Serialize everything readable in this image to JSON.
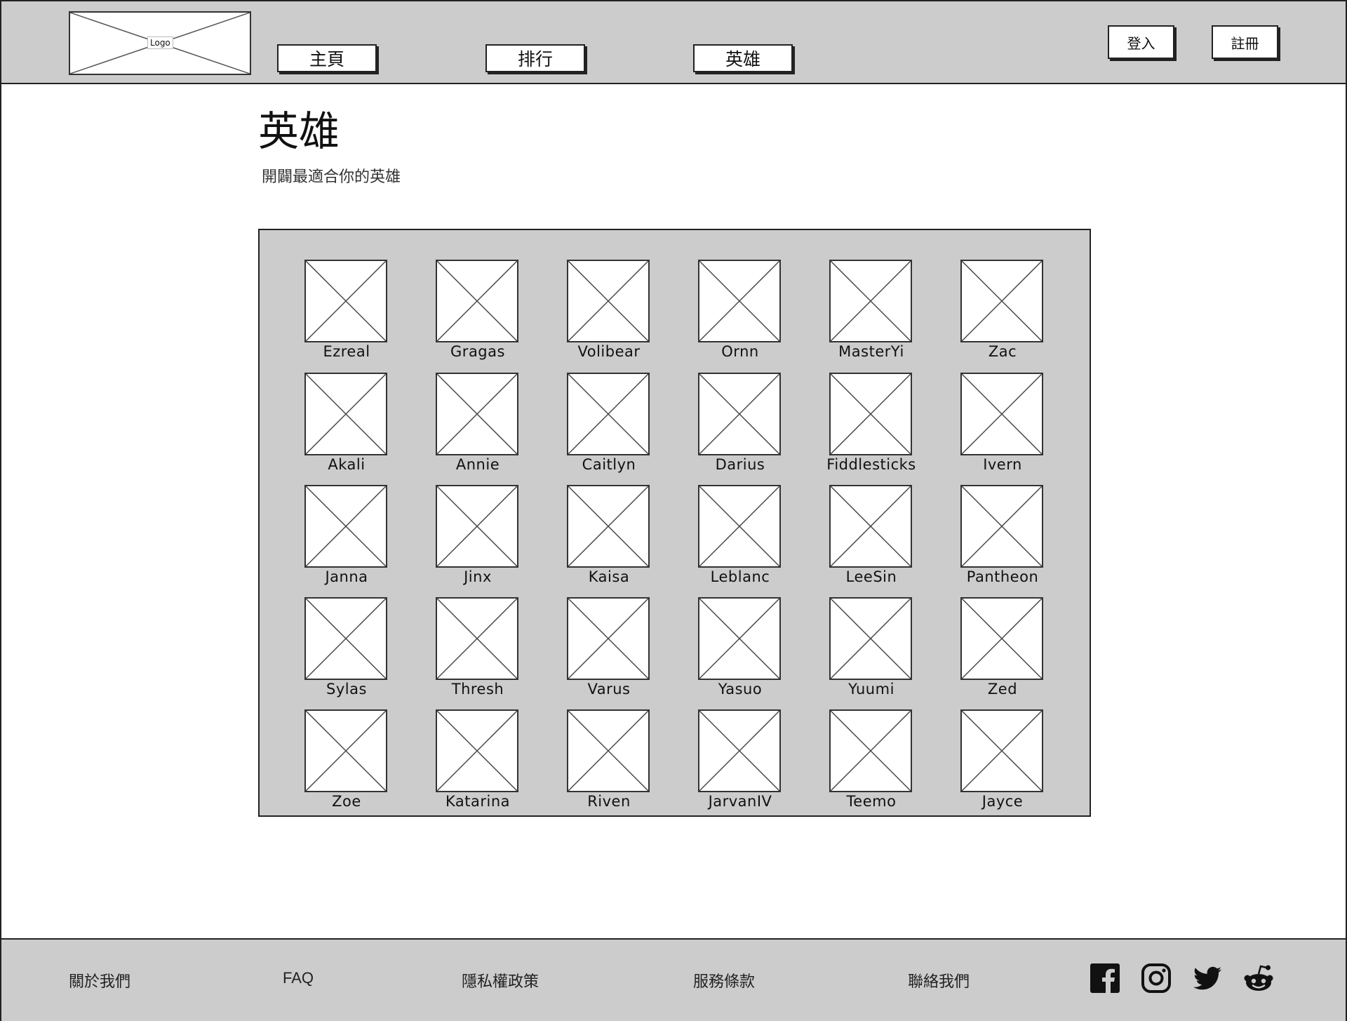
{
  "header": {
    "logo_label": "Logo",
    "nav": [
      {
        "label": "主頁"
      },
      {
        "label": "排行"
      },
      {
        "label": "英雄"
      }
    ],
    "login_label": "登入",
    "register_label": "註冊"
  },
  "main": {
    "title": "英雄",
    "subtitle": "開闢最適合你的英雄",
    "heroes": [
      "Ezreal",
      "Gragas",
      "Volibear",
      "Ornn",
      "MasterYi",
      "Zac",
      "Akali",
      "Annie",
      "Caitlyn",
      "Darius",
      "Fiddlesticks",
      "Ivern",
      "Janna",
      "Jinx",
      "Kaisa",
      "Leblanc",
      "LeeSin",
      "Pantheon",
      "Sylas",
      "Thresh",
      "Varus",
      "Yasuo",
      "Yuumi",
      "Zed",
      "Zoe",
      "Katarina",
      "Riven",
      "JarvanIV",
      "Teemo",
      "Jayce"
    ]
  },
  "footer": {
    "links": [
      {
        "label": "關於我們"
      },
      {
        "label": "FAQ"
      },
      {
        "label": "隱私權政策"
      },
      {
        "label": "服務條款"
      },
      {
        "label": "聯絡我們"
      }
    ],
    "social": [
      "facebook-icon",
      "instagram-icon",
      "twitter-icon",
      "reddit-icon"
    ]
  }
}
